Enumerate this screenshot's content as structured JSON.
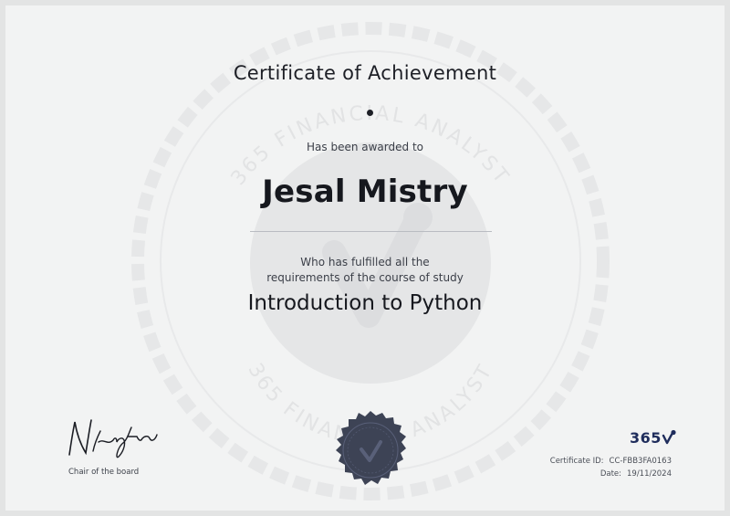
{
  "certificate": {
    "title": "Certificate of Achievement",
    "awarded_text": "Has been awarded to",
    "recipient_name": "Jesal Mistry",
    "fulfilled_line_1": "Who has fulfilled all the",
    "fulfilled_line_2": "requirements of the course of study",
    "course_name": "Introduction to Python"
  },
  "watermark": {
    "ring_text_top": "365 FINANCIAL ANALYST",
    "ring_text_bottom": "365 FINANCIAL ANALYST"
  },
  "signature": {
    "signer_script": "N.Krastev",
    "role": "Chair of the board"
  },
  "brand": {
    "logo_text": "365",
    "logo_icon": "checkmark-icon",
    "accent_color": "#1f2d5c",
    "seal_color": "#3d4355"
  },
  "meta": {
    "certificate_id_label": "Certificate ID:",
    "certificate_id_value": "CC-FBB3FA0163",
    "date_label": "Date:",
    "date_value": "19/11/2024"
  }
}
